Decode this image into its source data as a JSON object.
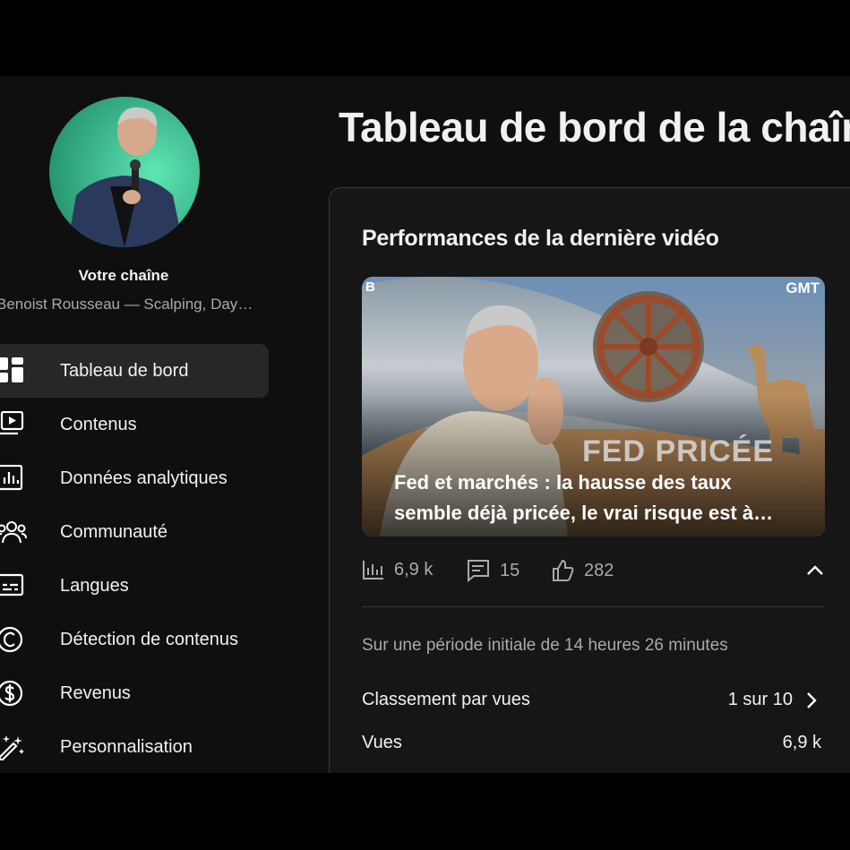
{
  "page": {
    "title": "Tableau de bord de la chaîne"
  },
  "sidebar": {
    "channel_title": "Votre chaîne",
    "channel_name": "Benoist Rousseau — Scalping, Day Trading",
    "items": [
      {
        "label": "Tableau de bord",
        "icon": "dashboard-icon",
        "active": true
      },
      {
        "label": "Contenus",
        "icon": "content-icon"
      },
      {
        "label": "Données analytiques",
        "icon": "analytics-icon"
      },
      {
        "label": "Communauté",
        "icon": "community-icon"
      },
      {
        "label": "Langues",
        "icon": "subtitles-icon"
      },
      {
        "label": "Détection de contenus",
        "icon": "copyright-icon"
      },
      {
        "label": "Revenus",
        "icon": "dollar-icon"
      },
      {
        "label": "Personnalisation",
        "icon": "magic-wand-icon"
      }
    ]
  },
  "card": {
    "title": "Performances de la dernière vidéo",
    "thumbnail": {
      "brand": "GMT",
      "logo": "B",
      "overlay_text": "FED PRICÉE",
      "caption_line1": "Fed et marchés : la hausse des taux",
      "caption_line2": "semble déjà pricée, le vrai risque est à…"
    },
    "stats": {
      "views": "6,9 k",
      "comments": "15",
      "likes": "282"
    },
    "period": "Sur une période initiale de 14 heures 26 minutes",
    "ranking": {
      "label": "Classement par vues",
      "value": "1 sur 10"
    },
    "views_row": {
      "label": "Vues",
      "value": "6,9 k"
    }
  },
  "colors": {
    "background": "#0f0f0f",
    "active_item": "#272727",
    "muted_text": "#aaaaaa",
    "accent_avatar": "#3fd9a0"
  }
}
